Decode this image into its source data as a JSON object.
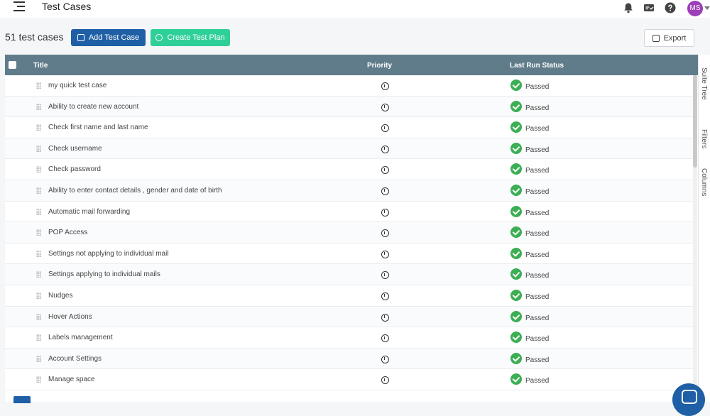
{
  "header": {
    "page_title": "Test Cases",
    "avatar_initials": "MS"
  },
  "toolbar": {
    "count_label": "51 test cases",
    "add_label": "Add Test Case",
    "plan_label": "Create Test Plan",
    "export_label": "Export"
  },
  "table": {
    "columns": [
      "Title",
      "Priority",
      "Last Run Status"
    ],
    "rows": [
      {
        "title": "my quick test case",
        "status": "Passed"
      },
      {
        "title": "Ability to create new account",
        "status": "Passed"
      },
      {
        "title": "Check first name and last name",
        "status": "Passed"
      },
      {
        "title": "Check username",
        "status": "Passed"
      },
      {
        "title": "Check password",
        "status": "Passed"
      },
      {
        "title": "Ability to enter contact details , gender and date of birth",
        "status": "Passed"
      },
      {
        "title": "Automatic mail forwarding",
        "status": "Passed"
      },
      {
        "title": "POP Access",
        "status": "Passed"
      },
      {
        "title": "Settings not applying to individual mail",
        "status": "Passed"
      },
      {
        "title": "Settings applying to individual mails",
        "status": "Passed"
      },
      {
        "title": "Nudges",
        "status": "Passed"
      },
      {
        "title": "Hover Actions",
        "status": "Passed"
      },
      {
        "title": "Labels management",
        "status": "Passed"
      },
      {
        "title": "Account Settings",
        "status": "Passed"
      },
      {
        "title": "Manage space",
        "status": "Passed"
      }
    ]
  },
  "side_panel": {
    "tabs": [
      "Suite Tree",
      "Filters",
      "Columns"
    ]
  },
  "colors": {
    "primary": "#1f5fa6",
    "accent_green": "#2fcf98",
    "header_bg": "#607c8a",
    "passed": "#3cae54",
    "avatar": "#9c3fb8"
  },
  "icons": {
    "menu": "menu-collapse-icon",
    "notifications": "bell-icon",
    "tasks": "task-check-icon",
    "help": "help-icon",
    "priority": "info-circle-icon",
    "status": "check-circle-icon",
    "drag": "drag-handle-icon"
  }
}
